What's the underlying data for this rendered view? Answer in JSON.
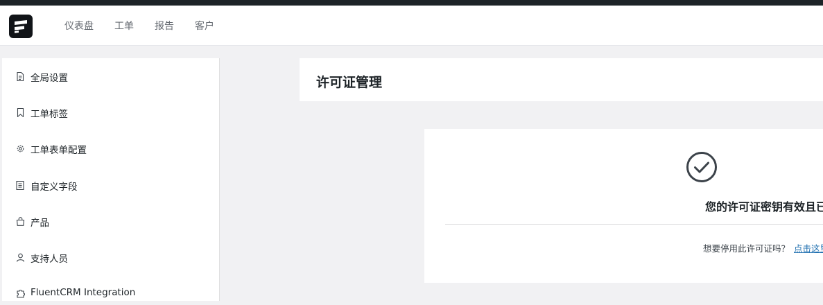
{
  "nav": {
    "items": [
      "仪表盘",
      "工单",
      "报告",
      "客户"
    ]
  },
  "sidebar": {
    "items": [
      {
        "label": "全局设置",
        "icon": "document-icon"
      },
      {
        "label": "工单标签",
        "icon": "bookmark-icon"
      },
      {
        "label": "工单表单配置",
        "icon": "gear-icon"
      },
      {
        "label": "自定义字段",
        "icon": "list-icon"
      },
      {
        "label": "产品",
        "icon": "shopping-bag-icon"
      },
      {
        "label": "支持人员",
        "icon": "user-icon"
      },
      {
        "label": "FluentCRM Integration",
        "icon": "puzzle-icon"
      }
    ]
  },
  "main": {
    "title": "许可证管理",
    "license": {
      "message": "您的许可证密钥有效且已激活",
      "deactivate_prompt": "想要停用此许可证吗？",
      "deactivate_link": "点击这里"
    }
  },
  "colors": {
    "accent_link": "#2271b1",
    "topbar": "#1d2327",
    "check_icon": "#3c434a"
  }
}
